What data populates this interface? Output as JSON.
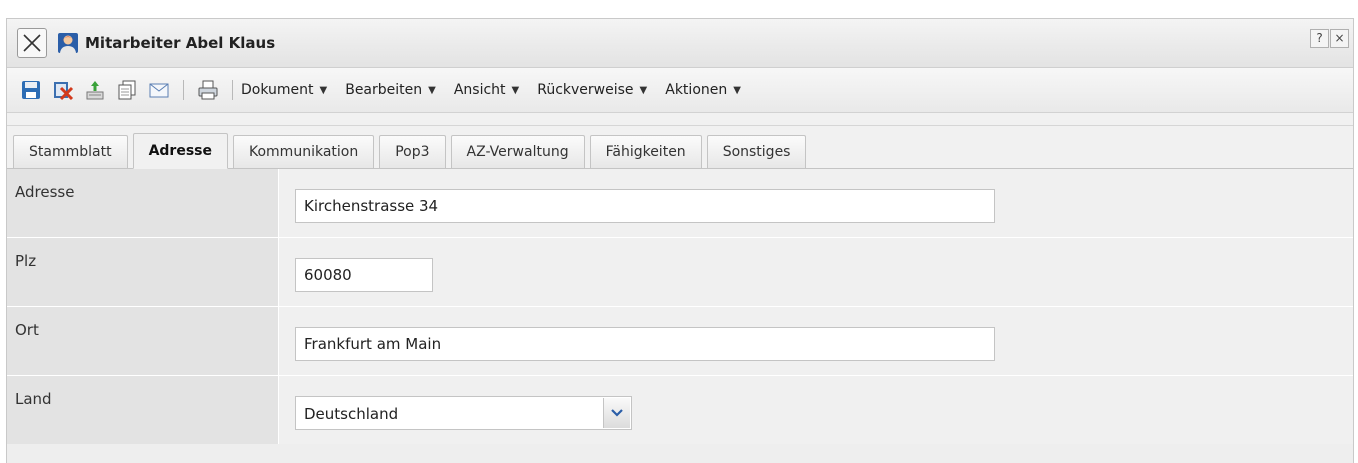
{
  "window": {
    "title": "Mitarbeiter Abel Klaus",
    "help_label": "?",
    "close_label": "×"
  },
  "toolbar": {
    "icons": [
      "save-icon",
      "delete-icon",
      "export-icon",
      "copy-icon",
      "mail-icon",
      "print-icon"
    ],
    "menus": [
      {
        "label": "Dokument"
      },
      {
        "label": "Bearbeiten"
      },
      {
        "label": "Ansicht"
      },
      {
        "label": "Rückverweise"
      },
      {
        "label": "Aktionen"
      }
    ]
  },
  "tabs": [
    {
      "label": "Stammblatt",
      "active": false
    },
    {
      "label": "Adresse",
      "active": true
    },
    {
      "label": "Kommunikation",
      "active": false
    },
    {
      "label": "Pop3",
      "active": false
    },
    {
      "label": "AZ-Verwaltung",
      "active": false
    },
    {
      "label": "Fähigkeiten",
      "active": false
    },
    {
      "label": "Sonstiges",
      "active": false
    }
  ],
  "form": {
    "adresse": {
      "label": "Adresse",
      "value": "Kirchenstrasse 34"
    },
    "plz": {
      "label": "Plz",
      "value": "60080"
    },
    "ort": {
      "label": "Ort",
      "value": "Frankfurt am Main"
    },
    "land": {
      "label": "Land",
      "value": "Deutschland"
    }
  },
  "colors": {
    "accent_blue": "#2b5ea8",
    "panel_bg": "#eeeeee",
    "label_bg": "#e3e3e3"
  }
}
